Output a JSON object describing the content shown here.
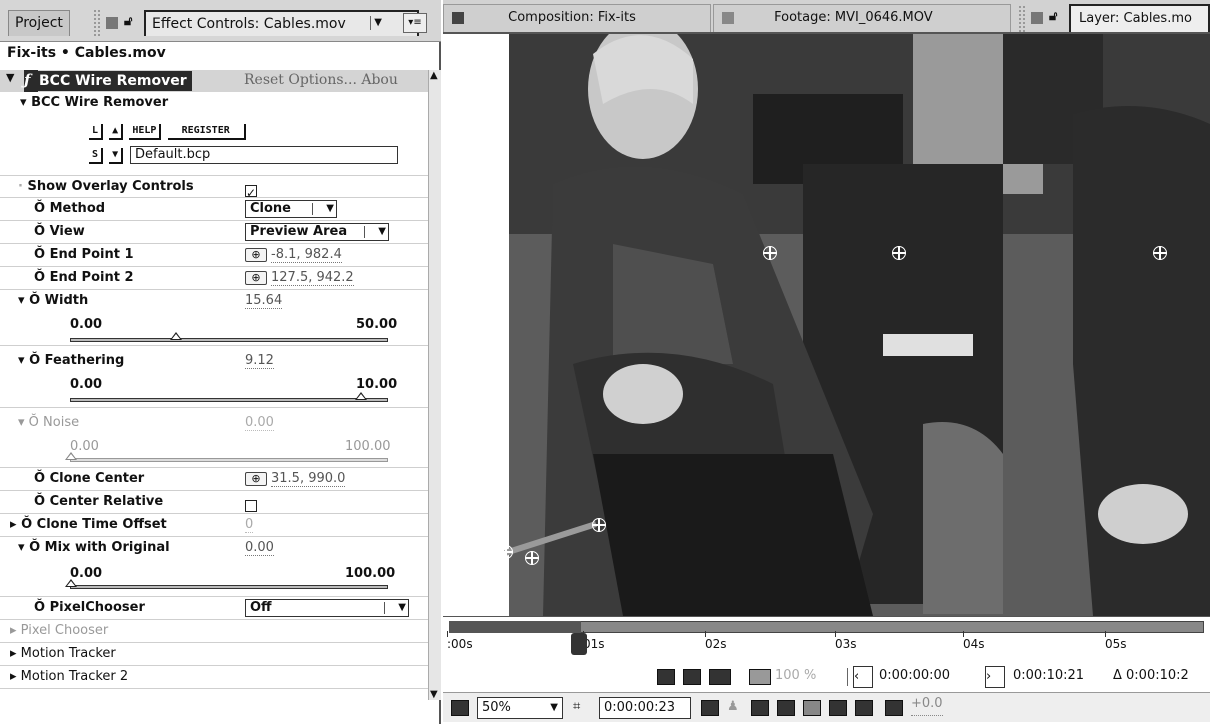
{
  "left_panel": {
    "tabs": {
      "project": "Project",
      "effect_controls": "Effect Controls: Cables.mov"
    },
    "breadcrumb": "Fix-its • Cables.mov",
    "effect": {
      "name": "BCC Wire Remover",
      "fx_glyph": "fx",
      "links": "Reset   Options...   Abou",
      "group_label": "BCC Wire Remover"
    },
    "preset": {
      "load_glyph": "L",
      "save_glyph": "S",
      "help_label": "HELP",
      "register_label": "REGISTER",
      "file_value": "Default.bcp"
    },
    "params": {
      "show_overlay": {
        "label": "Show Overlay Controls",
        "checked": true
      },
      "method": {
        "label": "Method",
        "value": "Clone"
      },
      "view": {
        "label": "View",
        "value": "Preview Area"
      },
      "end_point_1": {
        "label": "End Point 1",
        "value": "-8.1, 982.4"
      },
      "end_point_2": {
        "label": "End Point 2",
        "value": "127.5, 942.2"
      },
      "width": {
        "label": "Width",
        "value": "15.64",
        "min": "0.00",
        "max": "50.00",
        "fraction": 0.31
      },
      "feathering": {
        "label": "Feathering",
        "value": "9.12",
        "min": "0.00",
        "max": "10.00",
        "fraction": 0.91
      },
      "noise": {
        "label": "Noise",
        "value": "0.00",
        "min": "0.00",
        "max": "100.00",
        "fraction": 0.0
      },
      "clone_center": {
        "label": "Clone Center",
        "value": "31.5, 990.0"
      },
      "center_relative": {
        "label": "Center Relative",
        "checked": false
      },
      "clone_time_offset": {
        "label": "Clone Time Offset",
        "value": "0"
      },
      "mix_with_original": {
        "label": "Mix with Original",
        "value": "0.00",
        "min": "0.00",
        "max": "100.00",
        "fraction": 0.0
      },
      "pixelchooser": {
        "label": "PixelChooser",
        "value": "Off"
      }
    },
    "sections": {
      "pixel_chooser": "Pixel Chooser",
      "motion_tracker": "Motion Tracker",
      "motion_tracker_2": "Motion Tracker 2"
    }
  },
  "right_panel": {
    "tabs": {
      "composition": "Composition: Fix-its",
      "footage": "Footage: MVI_0646.MOV",
      "layer": "Layer: Cables.mo"
    },
    "timeline": {
      "ticks": [
        ":00s",
        "01s",
        "02s",
        "03s",
        "04s",
        "05s"
      ],
      "in_point": "0:00:00:00",
      "out_point": "0:00:10:21",
      "duration": "Δ 0:00:10:2",
      "zoom_percent": "100 %"
    },
    "footer": {
      "magnification": "50%",
      "current_time": "0:00:00:23",
      "exposure": "+0.0"
    }
  }
}
